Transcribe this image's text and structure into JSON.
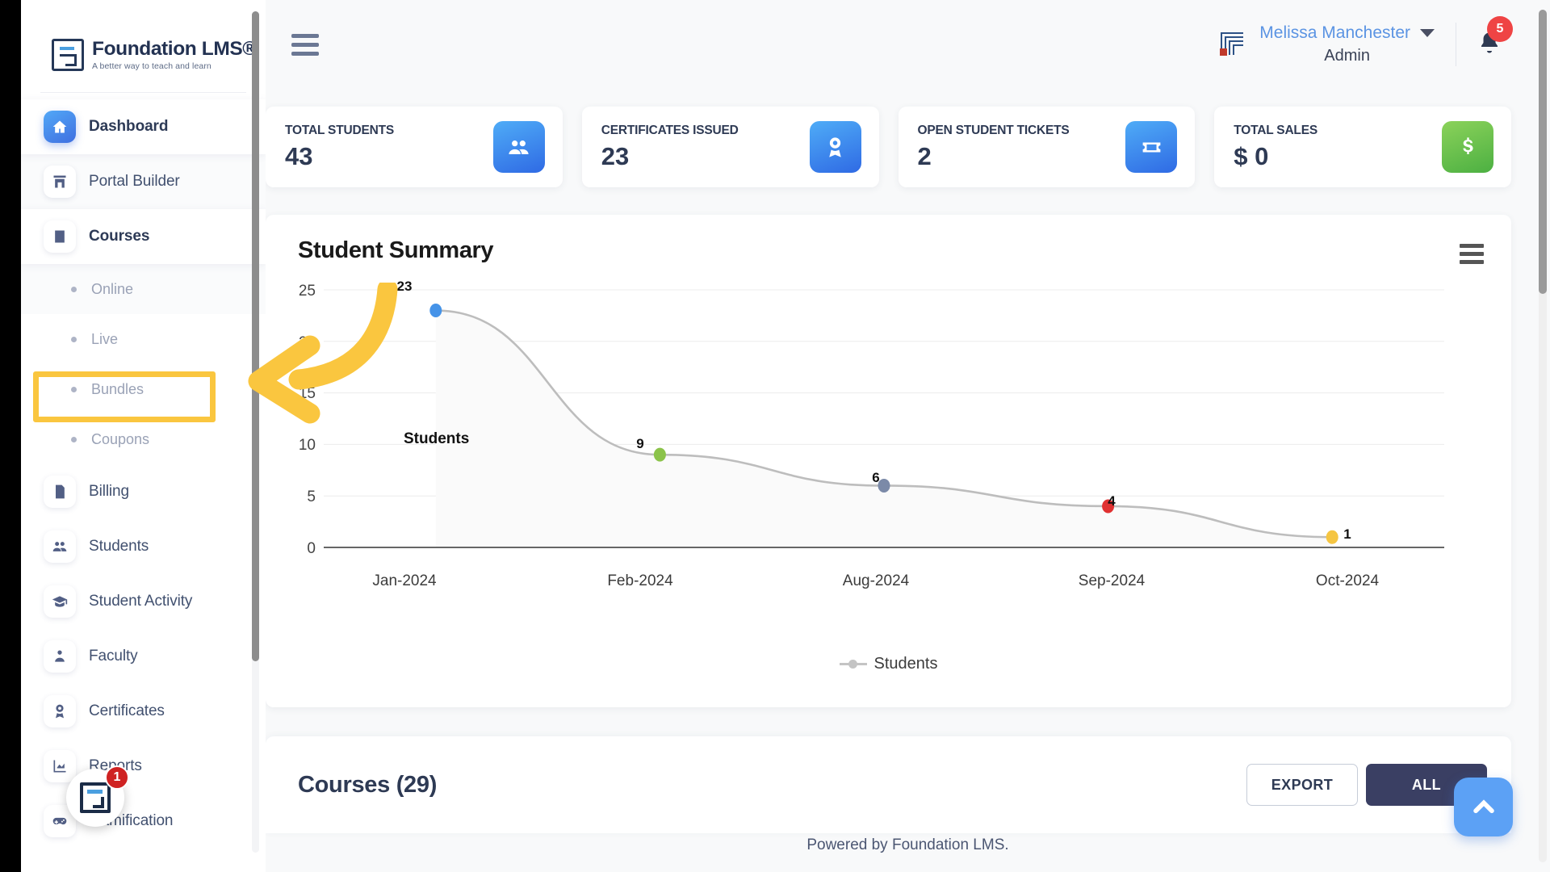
{
  "sidebar": {
    "logo": {
      "title": "Foundation LMS®",
      "tagline": "A better way to teach and learn"
    },
    "items": [
      {
        "label": "Dashboard",
        "icon": "home-icon",
        "active": true
      },
      {
        "label": "Portal Builder",
        "icon": "portal-icon",
        "active": false
      },
      {
        "label": "Courses",
        "icon": "book-icon",
        "active": true
      },
      {
        "label": "Billing",
        "icon": "invoice-icon",
        "active": false
      },
      {
        "label": "Students",
        "icon": "people-icon",
        "active": false
      },
      {
        "label": "Student Activity",
        "icon": "graduation-cap-icon",
        "active": false
      },
      {
        "label": "Faculty",
        "icon": "faculty-icon",
        "active": false
      },
      {
        "label": "Certificates",
        "icon": "certificate-icon",
        "active": false
      },
      {
        "label": "Reports",
        "icon": "chart-icon",
        "active": false
      },
      {
        "label": "Gamification",
        "icon": "gamepad-icon",
        "active": false
      }
    ],
    "subitems": [
      {
        "label": "Online"
      },
      {
        "label": "Live"
      },
      {
        "label": "Bundles"
      },
      {
        "label": "Coupons"
      }
    ],
    "highlighted_subitem": "Bundles",
    "float_badge_count": "1",
    "highlight_color": "#FAC63F"
  },
  "topbar": {
    "menu_icon": "hamburger-icon",
    "corner_logo": "company-logo-icon",
    "user_name": "Melissa Manchester",
    "user_role": "Admin",
    "notification_count": "5",
    "accent_user_color": "#5b94e3"
  },
  "stats": [
    {
      "label": "TOTAL STUDENTS",
      "value": "43",
      "icon": "people-icon",
      "color": "#3f7ce8"
    },
    {
      "label": "CERTIFICATES ISSUED",
      "value": "23",
      "icon": "certificate-icon",
      "color": "#3f7ce8"
    },
    {
      "label": "OPEN STUDENT TICKETS",
      "value": "2",
      "icon": "ticket-icon",
      "color": "#3f7ce8"
    },
    {
      "label": "TOTAL SALES",
      "value": "$ 0",
      "icon": "dollar-icon",
      "color": "#63b445"
    }
  ],
  "chart_panel": {
    "title": "Student Summary",
    "menu_icon": "chart-menu-icon"
  },
  "chart_data": {
    "type": "line",
    "title": "Student Summary",
    "categories": [
      "Jan-2024",
      "Feb-2024",
      "Aug-2024",
      "Sep-2024",
      "Oct-2024"
    ],
    "series": [
      {
        "name": "Students",
        "values": [
          23,
          9,
          6,
          4,
          1
        ]
      }
    ],
    "point_colors": [
      "#4593e8",
      "#8bc34a",
      "#7b8aa8",
      "#e03131",
      "#f5c542"
    ],
    "data_labels": [
      "23",
      "9",
      "6",
      "4",
      "1"
    ],
    "inline_series_label": "Students",
    "xlabel": "",
    "ylabel": "",
    "ylim": [
      0,
      25
    ],
    "yticks": [
      "0",
      "5",
      "10",
      "15",
      "20",
      "25"
    ],
    "grid": true,
    "legend": {
      "position": "bottom",
      "entries": [
        "Students"
      ]
    },
    "line_color": "#bdbdbd",
    "area_fill": "#fafafa"
  },
  "courses": {
    "title": "Courses (29)",
    "export_label": "EXPORT",
    "all_label": "ALL"
  },
  "footer": {
    "text": "Powered by Foundation LMS."
  },
  "fab": {
    "icon": "chevron-up-icon"
  }
}
